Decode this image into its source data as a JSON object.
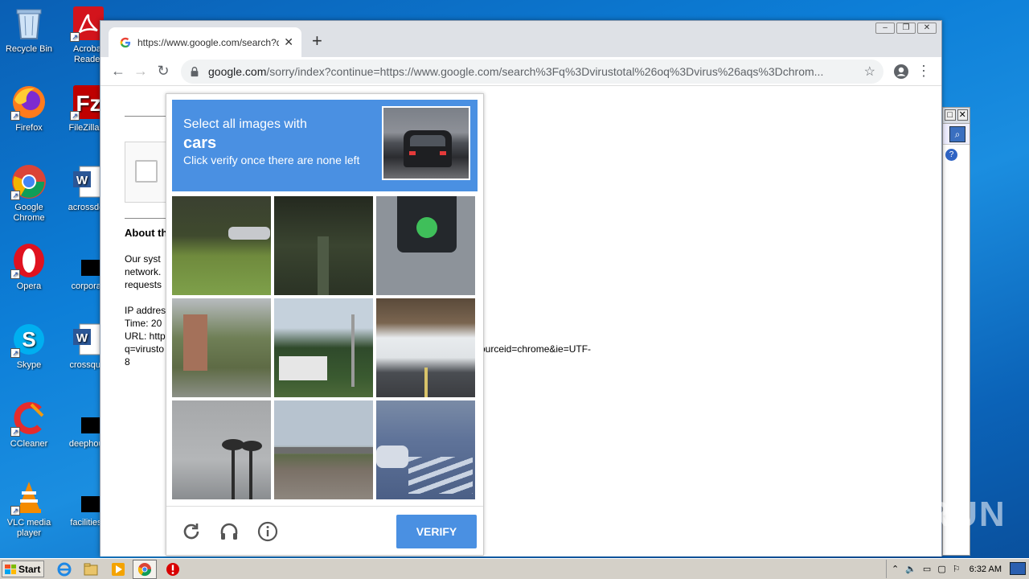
{
  "desktop": {
    "icons_col1": [
      "Recycle Bin",
      "Firefox",
      "Google Chrome",
      "Opera",
      "Skype",
      "CCleaner",
      "VLC media player"
    ],
    "icons_col2": [
      "Acrobat Reader",
      "FileZilla C",
      "acrossdea",
      "corporati",
      "crossquib",
      "deephous",
      "facilitiesd"
    ]
  },
  "browser": {
    "tab_title": "https://www.google.com/search?q=",
    "url_host": "google.com",
    "url_rest": "/sorry/index?continue=https://www.google.com/search%3Fq%3Dvirustotal%26oq%3Dvirus%26aqs%3Dchrom..."
  },
  "page": {
    "about_heading": "About th",
    "line1": "Our syst",
    "line2": "network.",
    "line3": "requests",
    "ip_line": "IP addres",
    "time_line": "Time: 20",
    "url_line": "URL: http",
    "q_line": "q=virusto",
    "url_tail": "ourceid=chrome&ie=UTF-",
    "eight": "8"
  },
  "captcha": {
    "instruction": "Select all images with",
    "target": "cars",
    "hint": "Click verify once there are none left",
    "verify_label": "VERIFY",
    "icons": [
      "reload-icon",
      "audio-icon",
      "info-icon"
    ]
  },
  "watermark": "ANY RUN",
  "taskbar": {
    "start_label": "Start",
    "clock": "6:32 AM"
  },
  "colors": {
    "captcha_blue": "#4a90e2",
    "desktop_blue": "#0d7fd8"
  }
}
